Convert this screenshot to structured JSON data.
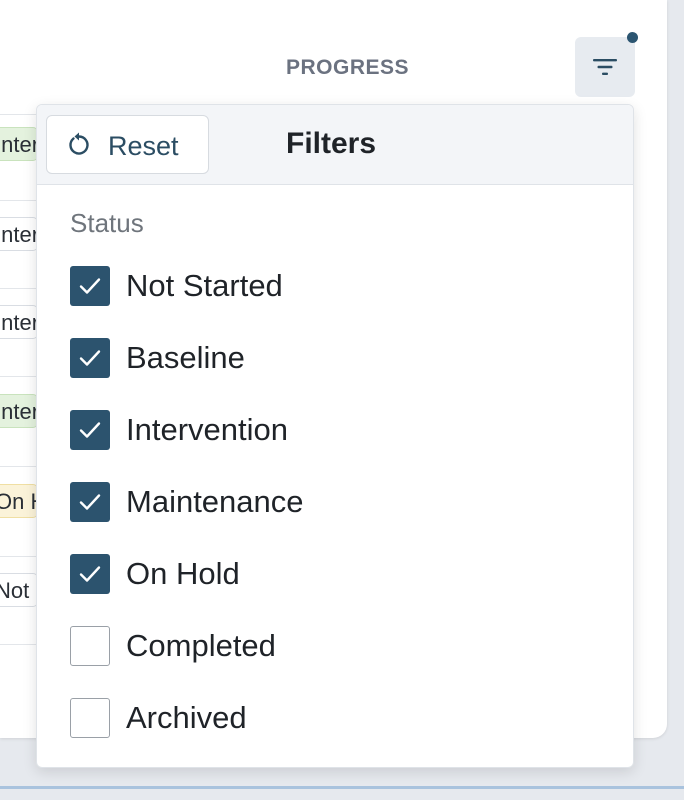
{
  "table": {
    "progress_header": "PROGRESS",
    "rows": [
      {
        "chip": "Intervention",
        "style": "green"
      },
      {
        "chip": "Intervention",
        "style": "plain"
      },
      {
        "chip": "Intervention",
        "style": "plain"
      },
      {
        "chip": "Intervention",
        "style": "green"
      },
      {
        "chip": "On Hold",
        "style": "yellow"
      },
      {
        "chip": "Not Started",
        "style": "plain"
      }
    ]
  },
  "filter_button": {
    "icon": "filter-icon",
    "indicator_color": "#2b5571"
  },
  "filters": {
    "title": "Filters",
    "reset_label": "Reset",
    "status_label": "Status",
    "options": [
      {
        "label": "Not Started",
        "checked": true
      },
      {
        "label": "Baseline",
        "checked": true
      },
      {
        "label": "Intervention",
        "checked": true
      },
      {
        "label": "Maintenance",
        "checked": true
      },
      {
        "label": "On Hold",
        "checked": true
      },
      {
        "label": "Completed",
        "checked": false
      },
      {
        "label": "Archived",
        "checked": false
      }
    ]
  },
  "colors": {
    "checked": "#2c536e",
    "accent_text": "#2b4d63"
  }
}
